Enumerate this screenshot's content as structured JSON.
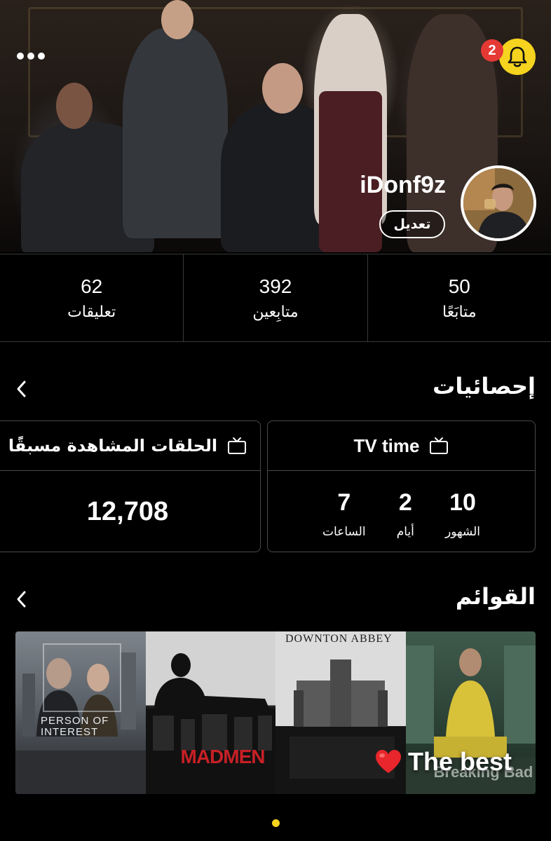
{
  "header": {
    "notification_count": "2",
    "username": "iDonf9z",
    "edit_label": "تعديل",
    "accent_color": "#f5d31e"
  },
  "stats": [
    {
      "value": "62",
      "label": "تعليقات"
    },
    {
      "value": "392",
      "label": "متابِعين"
    },
    {
      "value": "50",
      "label": "متابَعًا"
    }
  ],
  "statistics_section": {
    "title": "إحصائيات",
    "episodes_card": {
      "title": "الحلقات المشاهدة مسبقًا",
      "value": "12,708",
      "icon": "tv-icon"
    },
    "tv_time_card": {
      "title": "TV time",
      "icon": "tv-icon",
      "units": [
        {
          "value": "7",
          "label": "الساعات"
        },
        {
          "value": "2",
          "label": "أيام"
        },
        {
          "value": "10",
          "label": "الشهور"
        }
      ]
    }
  },
  "lists_section": {
    "title": "القوائم",
    "posters": [
      {
        "title": "PERSON OF INTEREST"
      },
      {
        "title": "MADMEN"
      },
      {
        "title": "DOWNTON ABBEY"
      },
      {
        "title": "Breaking Bad"
      }
    ],
    "list_name": "The best",
    "list_emoji": "heart"
  }
}
